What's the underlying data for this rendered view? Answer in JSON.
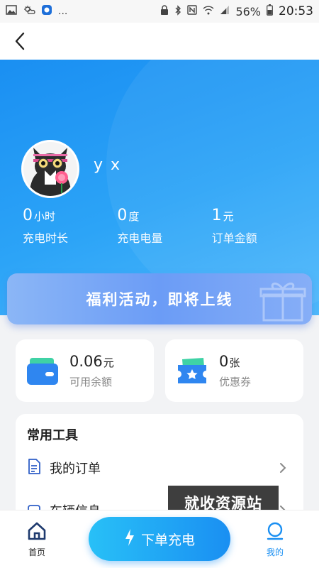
{
  "status_bar": {
    "dots": "...",
    "battery_percent": "56%",
    "time": "20:53"
  },
  "profile": {
    "username": "y x"
  },
  "stats": [
    {
      "value": "0",
      "unit": "小时",
      "label": "充电时长"
    },
    {
      "value": "0",
      "unit": "度",
      "label": "充电电量"
    },
    {
      "value": "1",
      "unit": "元",
      "label": "订单金额"
    }
  ],
  "promo": {
    "text": "福利活动，即将上线"
  },
  "cards": {
    "balance": {
      "value": "0.06",
      "unit": "元",
      "label": "可用余额"
    },
    "coupon": {
      "value": "0",
      "unit": "张",
      "label": "优惠券"
    }
  },
  "tools": {
    "title": "常用工具",
    "items": [
      {
        "label": "我的订单",
        "icon": "document-icon"
      },
      {
        "label": "车辆信息",
        "icon": "car-icon"
      }
    ]
  },
  "watermark": "就收资源站",
  "bottom_nav": {
    "home_label": "首页",
    "order_label": "下单充电",
    "mine_label": "我的"
  },
  "colors": {
    "accent": "#1a8ff2",
    "hero_start": "#1a8ff2",
    "hero_end": "#4fb9fb",
    "promo": "#6b9cf6"
  }
}
